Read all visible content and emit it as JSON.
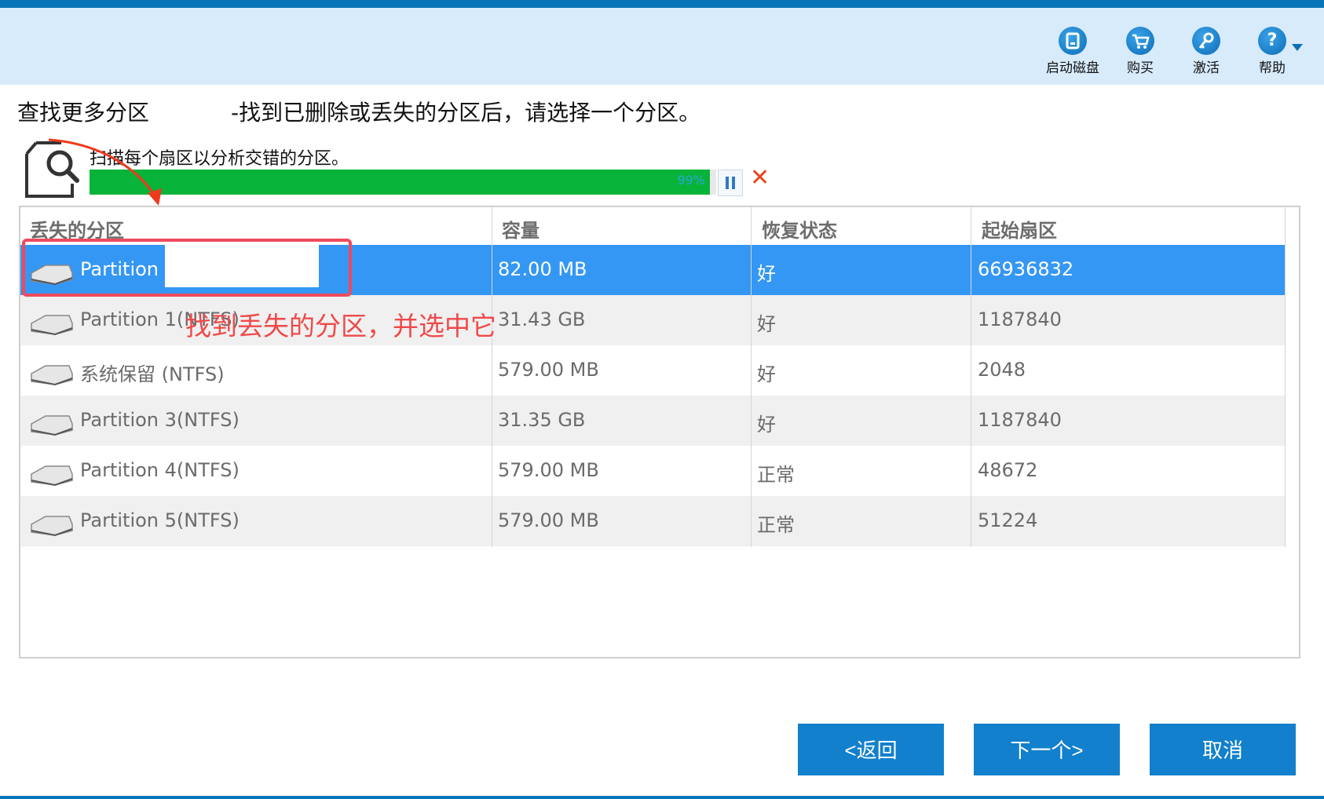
{
  "toolbar": {
    "items": [
      {
        "label": "启动磁盘",
        "icon": "boot-disk-icon"
      },
      {
        "label": "购买",
        "icon": "cart-icon"
      },
      {
        "label": "激活",
        "icon": "key-icon"
      },
      {
        "label": "帮助",
        "icon": "help-icon"
      }
    ]
  },
  "page": {
    "title": "查找更多分区",
    "subtitle": "-找到已删除或丢失的分区后，请选择一个分区。"
  },
  "scan": {
    "status_text": "扫描每个扇区以分析交错的分区。",
    "progress_label": "99%",
    "progress_fraction": 0.99
  },
  "table": {
    "columns": [
      "丢失的分区",
      "容量",
      "恢复状态",
      "起始扇区"
    ],
    "rows": [
      {
        "name": "Partition 0",
        "capacity": "82.00 MB",
        "status": "好",
        "start": "66936832"
      },
      {
        "name": "Partition 1(NTFS)",
        "capacity": "31.43 GB",
        "status": "好",
        "start": "1187840"
      },
      {
        "name": "系统保留 (NTFS)",
        "capacity": "579.00 MB",
        "status": "好",
        "start": "2048"
      },
      {
        "name": "Partition 3(NTFS)",
        "capacity": "31.35 GB",
        "status": "好",
        "start": "1187840"
      },
      {
        "name": "Partition 4(NTFS)",
        "capacity": "579.00 MB",
        "status": "正常",
        "start": "48672"
      },
      {
        "name": "Partition 5(NTFS)",
        "capacity": "579.00 MB",
        "status": "正常",
        "start": "51224"
      }
    ]
  },
  "annotation": {
    "text": "找到丢失的分区，并选中它"
  },
  "buttons": {
    "back": "<返回",
    "next": "下一个>",
    "cancel": "取消"
  },
  "colors": {
    "accent": "#1280cc",
    "selected_row": "#3497f4",
    "progress": "#08b33a",
    "annotation": "#ef4a4a"
  }
}
